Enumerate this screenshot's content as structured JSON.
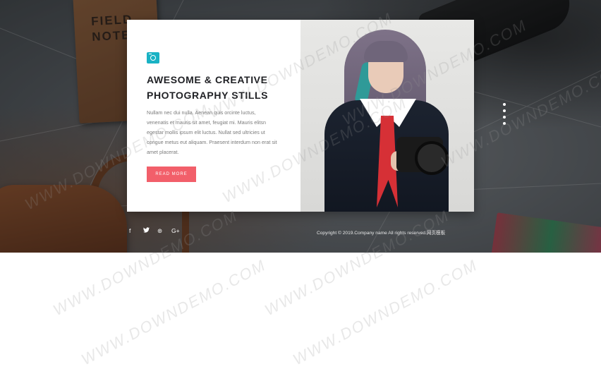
{
  "hero": {
    "notebook_text": "FIELD\nNOTE",
    "title": "AWESOME & CREATIVE PHOTOGRAPHY STILLS",
    "description": "Nullam nec dui nulla. Aenean quis orcinte luctus, venenatis et mauris sit amet, feugiat mi. Mauris elitsn egestar mollis ipsum elit luctus. Nullat sed ultricies ut congue metus eut aliquam. Praesent interdum non erat sit amet placerat.",
    "button_label": "READ MORE",
    "accent_color": "#f25f6a",
    "icon_color": "#19b2c4"
  },
  "slider": {
    "dot_count": 4
  },
  "social": {
    "icons": [
      {
        "name": "facebook-icon",
        "glyph": "f"
      },
      {
        "name": "twitter-icon",
        "glyph": "🐦"
      },
      {
        "name": "dribbble-icon",
        "glyph": "⊛"
      },
      {
        "name": "google-plus-icon",
        "glyph": "G+"
      }
    ]
  },
  "footer": {
    "copyright": "Copyright © 2019.Company name All rights reserved.网页模板"
  },
  "watermark": {
    "text": "WWW.DOWNDEMO.COM"
  }
}
